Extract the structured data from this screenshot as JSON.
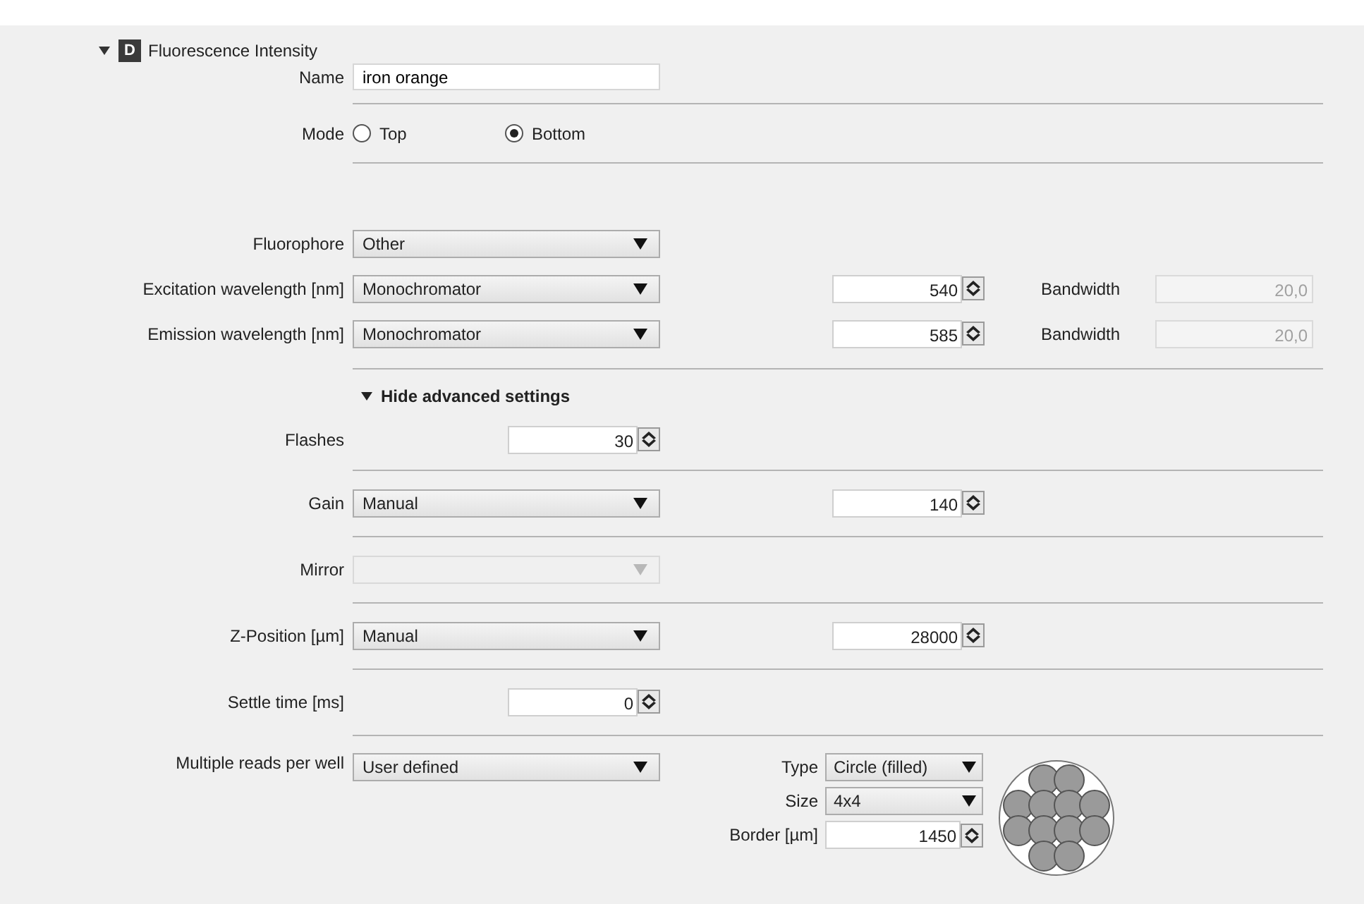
{
  "header": {
    "expanded": true,
    "badge": "D",
    "title": "Fluorescence Intensity"
  },
  "sections": [
    {
      "rows": [
        {
          "kind": "text",
          "label": "Name",
          "value": "iron orange"
        }
      ]
    },
    {
      "rows": [
        {
          "kind": "radio",
          "label": "Mode",
          "options": [
            {
              "label": "Top",
              "selected": false
            },
            {
              "label": "Bottom",
              "selected": true
            }
          ]
        }
      ]
    },
    {
      "rows": [
        {
          "kind": "select",
          "label": "Fluorophore",
          "select": {
            "value": "Other",
            "disabled": false
          }
        },
        {
          "kind": "select",
          "label": "Excitation wavelength [nm]",
          "select": {
            "value": "Monochromator",
            "disabled": false
          },
          "spin": {
            "value": "540"
          },
          "bandwidth": {
            "label": "Bandwidth",
            "value": "20,0",
            "disabled": true
          }
        },
        {
          "kind": "select",
          "label": "Emission wavelength [nm]",
          "select": {
            "value": "Monochromator",
            "disabled": false
          },
          "spin": {
            "value": "585"
          },
          "bandwidth": {
            "label": "Bandwidth",
            "value": "20,0",
            "disabled": true
          }
        }
      ]
    },
    {
      "rows": [
        {
          "kind": "toggle",
          "label": "Hide advanced settings",
          "expanded": true
        },
        {
          "kind": "spin",
          "label": "Flashes",
          "spin": {
            "value": "30"
          }
        }
      ]
    },
    {
      "rows": [
        {
          "kind": "select",
          "label": "Gain",
          "select": {
            "value": "Manual",
            "disabled": false
          },
          "spin": {
            "value": "140"
          }
        }
      ]
    },
    {
      "rows": [
        {
          "kind": "select",
          "label": "Mirror",
          "select": {
            "disabled": true
          }
        }
      ]
    },
    {
      "rows": [
        {
          "kind": "select",
          "label": "Z-Position [µm]",
          "select": {
            "value": "Manual",
            "disabled": false
          },
          "spin": {
            "value": "28000"
          }
        }
      ]
    },
    {
      "rows": [
        {
          "kind": "spin",
          "label": "Settle time [ms]",
          "spin": {
            "value": "0"
          }
        }
      ]
    },
    {
      "rows": [
        {
          "kind": "select",
          "label": "Multiple reads per well",
          "select": {
            "value": "User defined",
            "disabled": false
          },
          "fields": [
            {
              "kind": "select",
              "label": "Type",
              "value": "Circle (filled)"
            },
            {
              "kind": "select",
              "label": "Size",
              "value": "4x4"
            },
            {
              "kind": "spin",
              "label": "Border [µm]",
              "value": "1450"
            }
          ]
        }
      ]
    }
  ]
}
